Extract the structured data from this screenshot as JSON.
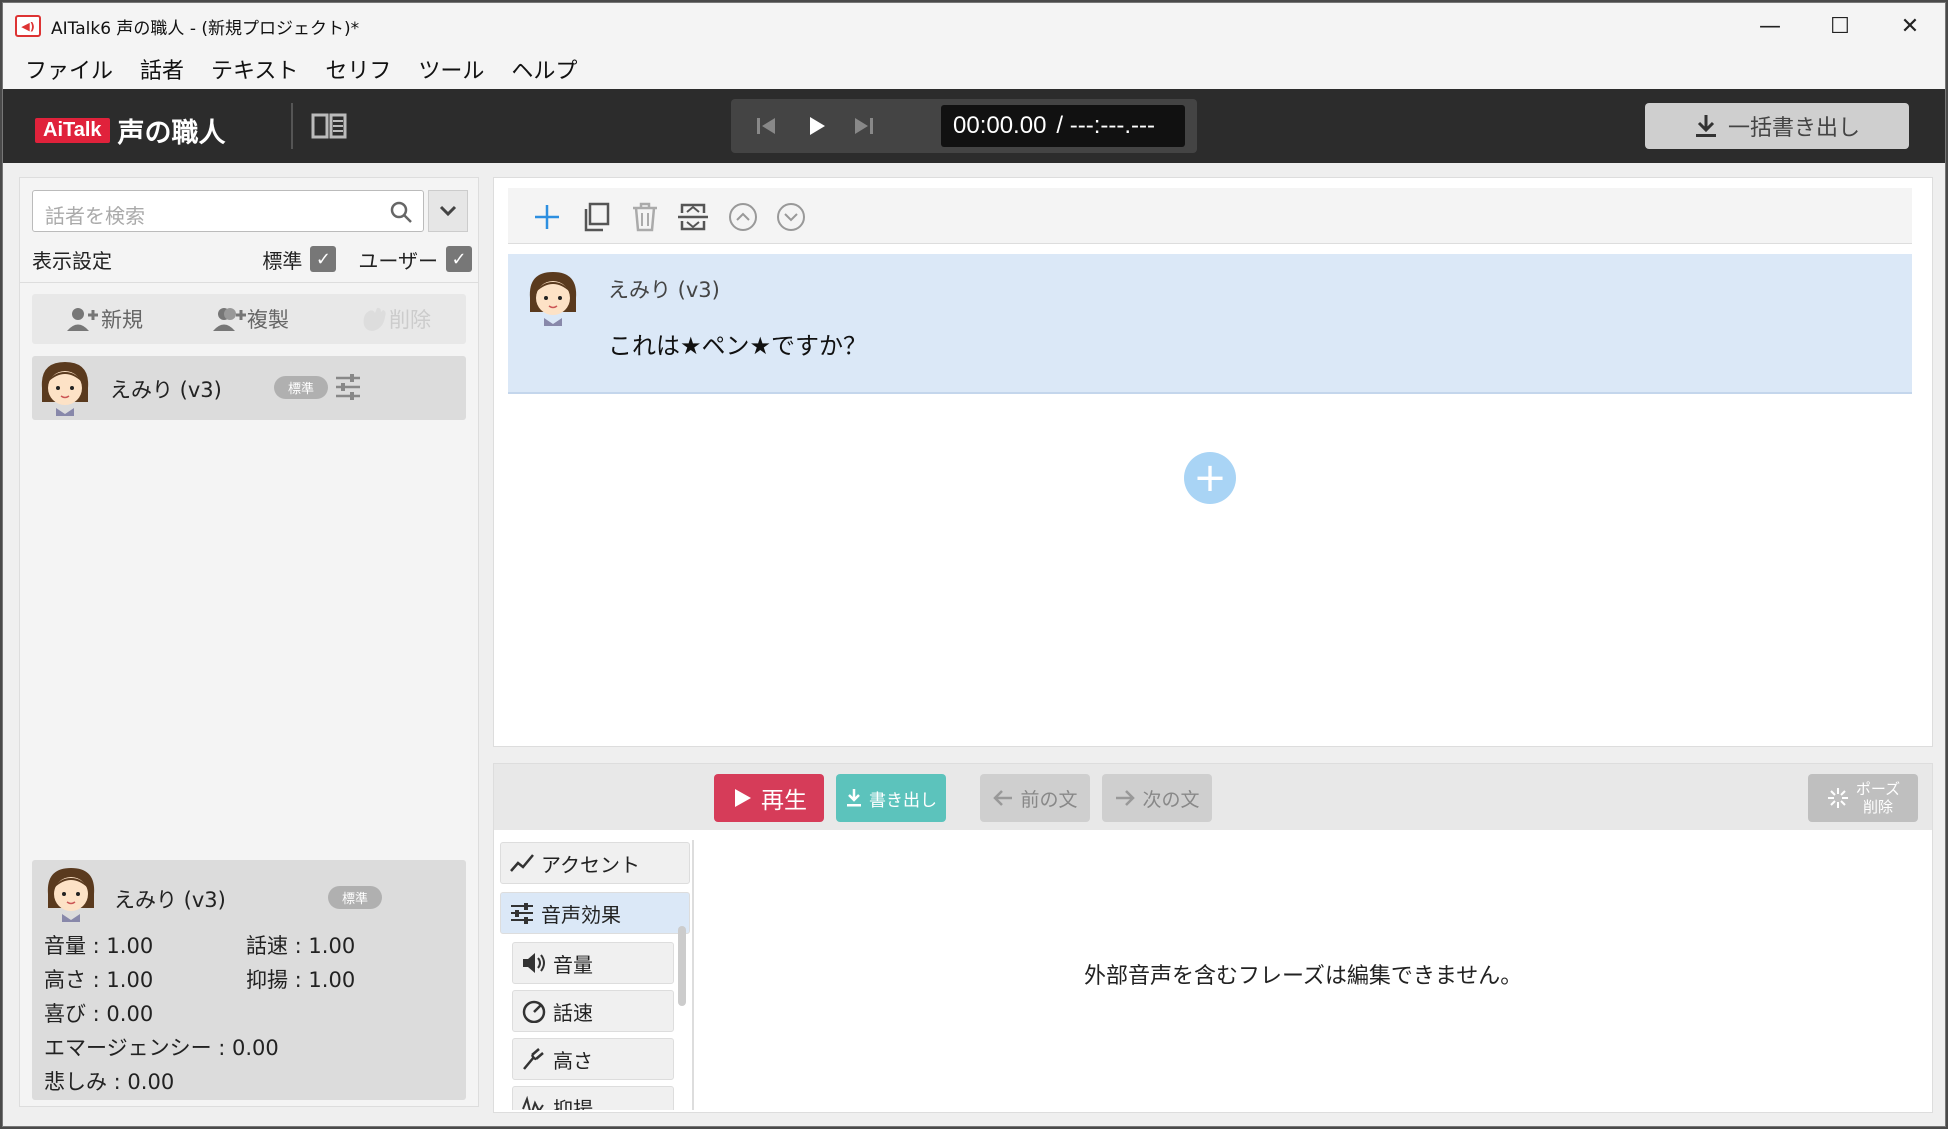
{
  "window": {
    "title": "AITalk6 声の職人 - (新規プロジェクト)*",
    "controls": [
      "minimize-icon",
      "maximize-icon",
      "close-icon"
    ]
  },
  "menu": [
    "ファイル",
    "話者",
    "テキスト",
    "セリフ",
    "ツール",
    "ヘルプ"
  ],
  "toolbar": {
    "logo_badge": "AiTalk",
    "logo_text": "声の職人",
    "time_current": "00:00.00",
    "time_total": "/ ---:---.---",
    "export_all": "一括書き出し"
  },
  "left": {
    "search_placeholder": "話者を検索",
    "display_settings": "表示設定",
    "filter_standard": "標準",
    "filter_user": "ユーザー",
    "actions": [
      "新規",
      "複製",
      "削除"
    ],
    "speaker": {
      "name": "えみり (v3)",
      "badge": "標準"
    },
    "info": {
      "name": "えみり (v3)",
      "badge": "標準",
      "volume": "音量 : 1.00",
      "speed": "話速 : 1.00",
      "pitch": "高さ : 1.00",
      "intonation": "抑揚 : 1.00",
      "joy": "喜び : 0.00",
      "emergency": "エマージェンシー : 0.00",
      "sadness": "悲しみ : 0.00"
    }
  },
  "editor": {
    "line": {
      "speaker": "えみり (v3)",
      "text": "これは★ペン★ですか？"
    }
  },
  "tune": {
    "play": "再生",
    "export": "書き出し",
    "prev": "前の文",
    "next": "次の文",
    "pause_line1": "ポーズ",
    "pause_line2": "削除",
    "tabs": [
      "アクセント",
      "音声効果"
    ],
    "subitems": [
      "音量",
      "話速",
      "高さ",
      "抑揚"
    ],
    "message": "外部音声を含むフレーズは編集できません。"
  },
  "colors": {
    "accent": "#e0223b",
    "play": "#d63c59",
    "export": "#5cc3bc",
    "selected": "#dbe8f7"
  }
}
